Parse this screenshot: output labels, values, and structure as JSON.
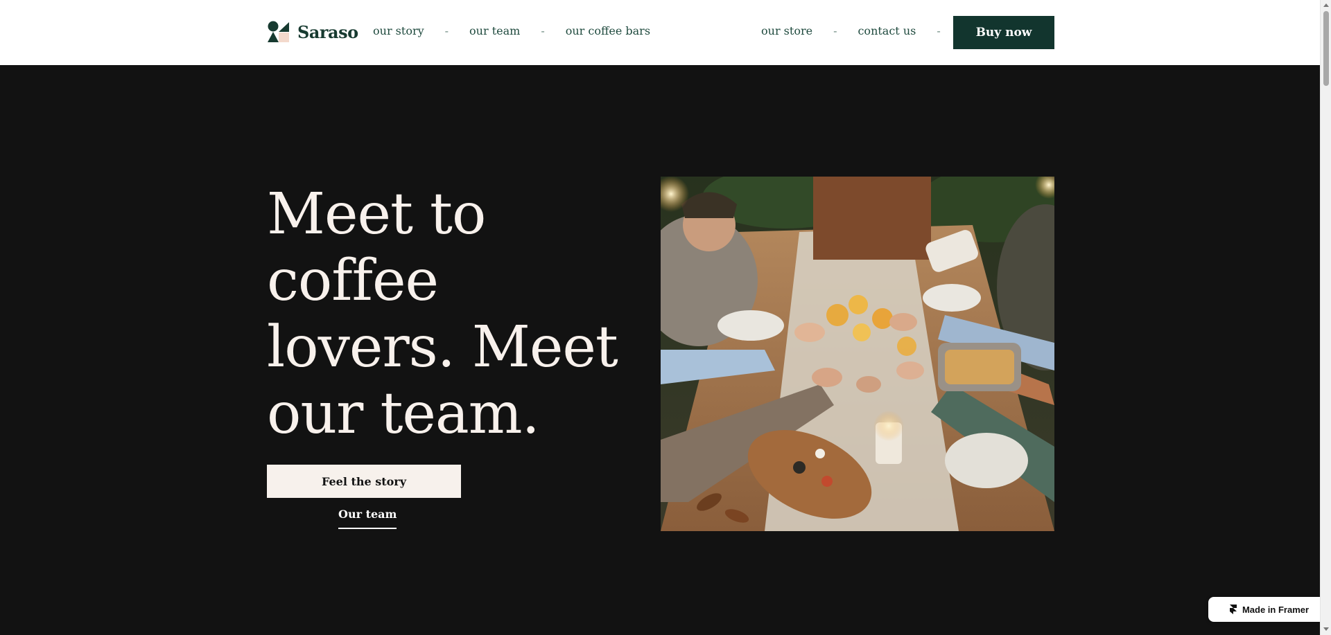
{
  "brand": {
    "name": "Saraso"
  },
  "nav": {
    "left": [
      {
        "label": "our story"
      },
      {
        "label": "our team"
      },
      {
        "label": "our coffee bars"
      }
    ],
    "right": [
      {
        "label": "our store"
      },
      {
        "label": "contact us"
      }
    ],
    "separator": "-",
    "buy_label": "Buy now"
  },
  "hero": {
    "title": "Meet to coffee lovers. Meet our team.",
    "primary_cta": "Feel the story",
    "secondary_cta": "Our team"
  },
  "badge": {
    "label": "Made in Framer"
  },
  "colors": {
    "brand_green": "#12352e",
    "hero_bg": "#121212",
    "cream": "#f7f1ec"
  },
  "icons": {
    "logo": "saraso-logo-icon",
    "framer": "framer-icon"
  }
}
